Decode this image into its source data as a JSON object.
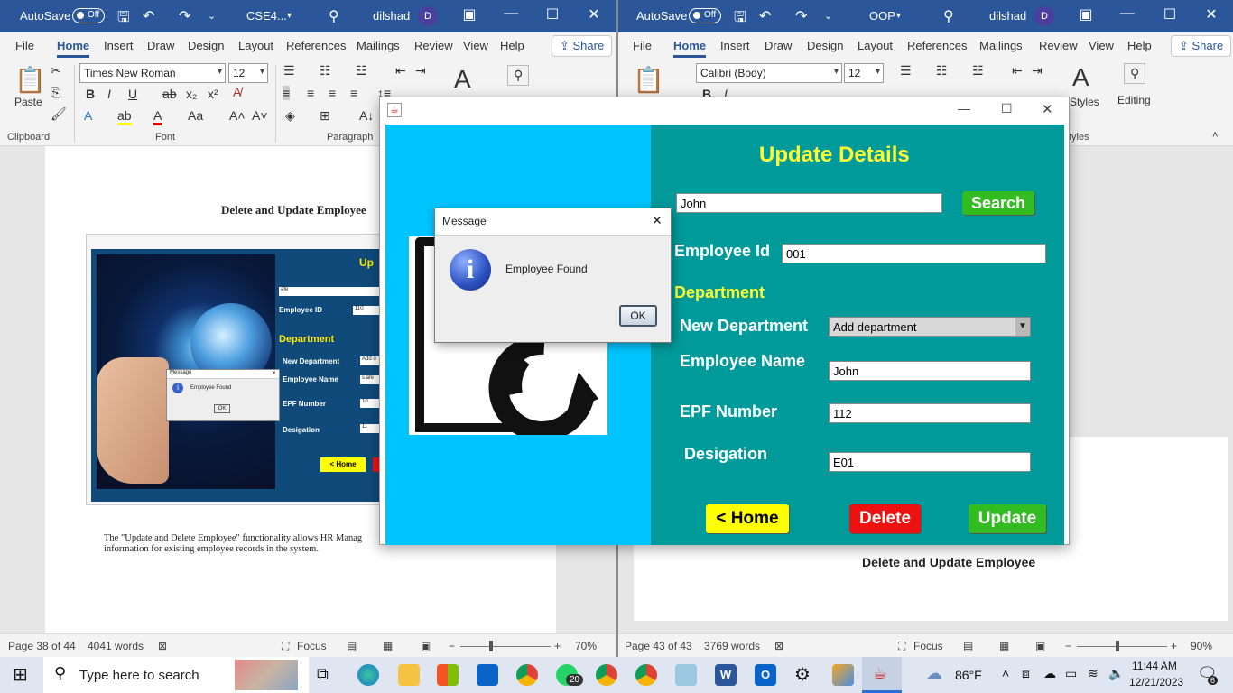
{
  "left_window": {
    "autosave_label": "AutoSave",
    "autosave_state": "Off",
    "doc_title": "CSE4...",
    "user": "dilshad",
    "avatar_initial": "D",
    "tabs": [
      "File",
      "Home",
      "Insert",
      "Draw",
      "Design",
      "Layout",
      "References",
      "Mailings",
      "Review",
      "View",
      "Help"
    ],
    "share_label": "Share",
    "font_name": "Times New Roman",
    "font_size": "12",
    "paste_label": "Paste",
    "group_labels": {
      "clipboard": "Clipboard",
      "font": "Font",
      "paragraph": "Paragraph"
    },
    "page_heading": "Delete and Update Employee",
    "thumb": {
      "title_partial": "Up",
      "search_value": "afe",
      "employee_id_label": "Employee ID",
      "employee_id_value": "110",
      "department_label": "Department",
      "new_department_label": "New Department",
      "new_department_value": "Add d",
      "employee_name_label": "Employee Name",
      "employee_name_value": "s.afe",
      "epf_label": "EPF Number",
      "epf_value": "10",
      "designation_label": "Desigation",
      "designation_value": "11",
      "home_button": "< Home",
      "msg_title": "Message",
      "msg_text": "Employee Found",
      "msg_ok": "OK"
    },
    "paragraph_line1": "The \"Update and Delete Employee\" functionality allows HR Manag",
    "paragraph_line2": "information for existing employee records in the system.",
    "status": {
      "page": "Page 38 of 44",
      "words": "4041 words",
      "focus": "Focus",
      "zoom": "70%"
    }
  },
  "right_window": {
    "autosave_label": "AutoSave",
    "autosave_state": "Off",
    "doc_title": "OOP",
    "user": "dilshad",
    "avatar_initial": "D",
    "tabs": [
      "File",
      "Home",
      "Insert",
      "Draw",
      "Design",
      "Layout",
      "References",
      "Mailings",
      "Review",
      "View",
      "Help"
    ],
    "share_label": "Share",
    "font_name": "Calibri (Body)",
    "font_size": "12",
    "styles_label": "Styles",
    "editing_label": "Editing",
    "styles_group_partial": "tyles",
    "page_heading": "Delete and Update Employee",
    "status": {
      "page": "Page 43 of 43",
      "words": "3769 words",
      "focus": "Focus",
      "zoom": "90%"
    }
  },
  "java_app": {
    "heading": "Update Details",
    "search_value": "John",
    "search_button": "Search",
    "employee_id_label": "Employee Id",
    "employee_id_value": "001",
    "department_label": "Department",
    "new_department_label": "New Department",
    "new_department_value": "Add department",
    "employee_name_label": "Employee Name",
    "employee_name_value": "John",
    "epf_label": "EPF Number",
    "epf_value": "112",
    "designation_label": "Desigation",
    "designation_value": "E01",
    "home_button": "< Home",
    "delete_button": "Delete",
    "update_button": "Update"
  },
  "message_dialog": {
    "title": "Message",
    "text": "Employee Found",
    "ok": "OK"
  },
  "taskbar": {
    "search_placeholder": "Type here to search",
    "whatsapp_badge": "20",
    "weather": "86°F",
    "time": "11:44 AM",
    "date": "12/21/2023",
    "notification_count": "6"
  },
  "colors": {
    "word_blue": "#2b579a",
    "java_left": "#00c4ff",
    "java_right": "#009a9a",
    "heading_yellow": "#ffff33",
    "btn_green": "#33bb22",
    "btn_red": "#ee1111",
    "btn_yellow": "#ffff00"
  }
}
